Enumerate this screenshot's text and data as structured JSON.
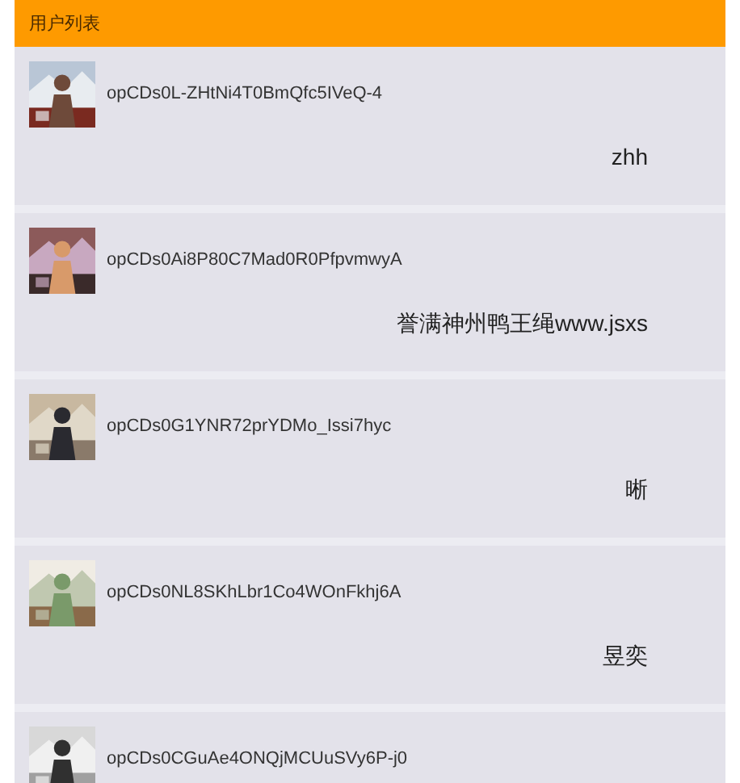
{
  "header": {
    "title": "用户列表"
  },
  "users": [
    {
      "openid": "opCDs0L-ZHtNi4T0BmQfc5IVeQ-4",
      "nickname": "zhh"
    },
    {
      "openid": "opCDs0Ai8P80C7Mad0R0PfpvmwyA",
      "nickname": "誉满神州鸭王绳www.jsxs"
    },
    {
      "openid": "opCDs0G1YNR72prYDMo_Issi7hyc",
      "nickname": "晰"
    },
    {
      "openid": "opCDs0NL8SKhLbr1Co4WOnFkhj6A",
      "nickname": "昱奕"
    },
    {
      "openid": "opCDs0CGuAe4ONQjMCUuSVy6P-j0"
    }
  ]
}
